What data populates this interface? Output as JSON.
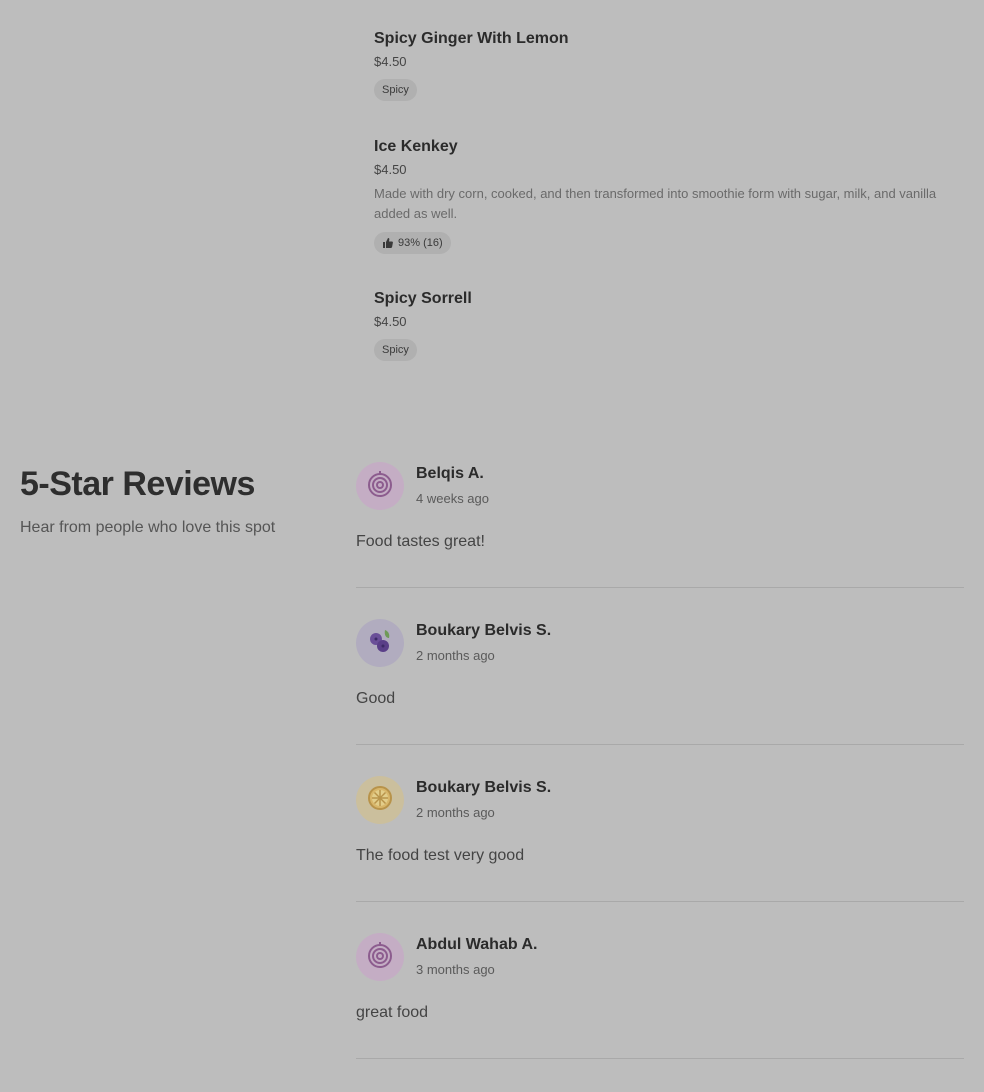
{
  "menu": {
    "items": [
      {
        "name": "Spicy Ginger With Lemon",
        "price": "$4.50",
        "description": "",
        "tag": "Spicy"
      },
      {
        "name": "Ice Kenkey",
        "price": "$4.50",
        "description": "Made with dry corn, cooked, and then transformed into smoothie form with sugar, milk, and vanilla added as well.",
        "tag": "93% (16)",
        "tag_icon": "thumbs-up-icon"
      },
      {
        "name": "Spicy Sorrell",
        "price": "$4.50",
        "description": "",
        "tag": "Spicy"
      }
    ]
  },
  "reviews": {
    "title": "5-Star Reviews",
    "subtitle": "Hear from people who love this spot",
    "items": [
      {
        "name": "Belqis A.",
        "date": "4 weeks ago",
        "text": "Food tastes great!",
        "avatar_icon": "onion-icon",
        "avatar_bg": "#c4adc4"
      },
      {
        "name": "Boukary Belvis S.",
        "date": "2 months ago",
        "text": "Good",
        "avatar_icon": "blueberry-icon",
        "avatar_bg": "#b1acbf"
      },
      {
        "name": "Boukary Belvis S.",
        "date": "2 months ago",
        "text": "The food test very good",
        "avatar_icon": "lemon-icon",
        "avatar_bg": "#cbbf9d"
      },
      {
        "name": "Abdul Wahab A.",
        "date": "3 months ago",
        "text": "great food",
        "avatar_icon": "onion-icon",
        "avatar_bg": "#c4adc4"
      }
    ]
  }
}
